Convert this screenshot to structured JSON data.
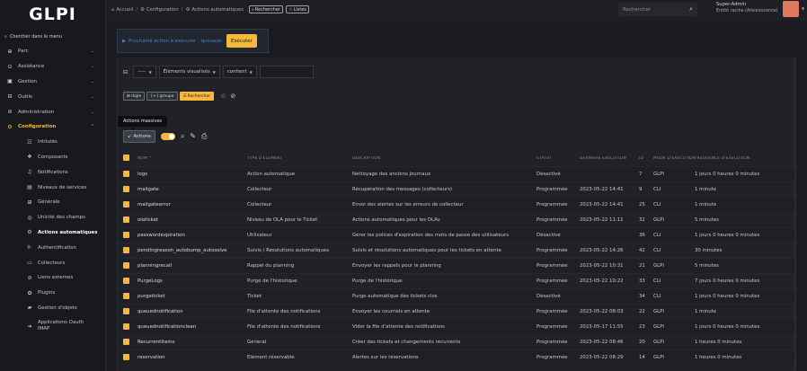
{
  "app": {
    "logo": "GLPI"
  },
  "sidebar": {
    "search_label": "Chercher dans le menu",
    "items": [
      {
        "label": "Parc",
        "icon": "parc-icon",
        "glyph": "⊕"
      },
      {
        "label": "Assistance",
        "icon": "assistance-icon",
        "glyph": "⊙"
      },
      {
        "label": "Gestion",
        "icon": "gestion-icon",
        "glyph": "▣"
      },
      {
        "label": "Outils",
        "icon": "outils-icon",
        "glyph": "⊟"
      },
      {
        "label": "Administration",
        "icon": "administration-icon",
        "glyph": "⊘"
      },
      {
        "label": "Configuration",
        "icon": "configuration-icon",
        "glyph": "⚙"
      }
    ],
    "sub_items": [
      {
        "label": "Intitulés",
        "icon": "dropdowns-icon",
        "glyph": "☷"
      },
      {
        "label": "Composants",
        "icon": "components-icon",
        "glyph": "❖"
      },
      {
        "label": "Notifications",
        "icon": "bell-icon",
        "glyph": "♫"
      },
      {
        "label": "Niveaux de services",
        "icon": "sla-icon",
        "glyph": "▤"
      },
      {
        "label": "Générale",
        "icon": "general-icon",
        "glyph": "⊞"
      },
      {
        "label": "Unicité des champs",
        "icon": "fingerprint-icon",
        "glyph": "◎"
      },
      {
        "label": "Actions automatiques",
        "icon": "crontask-icon",
        "glyph": "⚙"
      },
      {
        "label": "Authentification",
        "icon": "auth-icon",
        "glyph": "⊩"
      },
      {
        "label": "Collecteurs",
        "icon": "collector-icon",
        "glyph": "▭"
      },
      {
        "label": "Liens externes",
        "icon": "link-icon",
        "glyph": "⊘"
      },
      {
        "label": "Plugins",
        "icon": "plugin-icon",
        "glyph": "✿"
      },
      {
        "label": "Gestion d'objets",
        "icon": "objects-icon",
        "glyph": "▰"
      },
      {
        "label": "Applications Oauth IMAP",
        "icon": "oauth-icon",
        "glyph": "➜"
      }
    ]
  },
  "topbar": {
    "crumbs": [
      "Accueil",
      "Configuration",
      "Actions automatiques"
    ],
    "search_btn": "Rechercher",
    "lists_btn": "Listes",
    "search_placeholder": "Rechercher",
    "user_name": "Super-Admin",
    "user_entity": "Entité racine (Arborescence)"
  },
  "notice": {
    "text": "Prochaine action à exécuter : queuedn",
    "exec_label": "Exécuter"
  },
  "filter": {
    "field1": "-----",
    "field2": "Éléments visualisés",
    "field3": "contient",
    "value": ""
  },
  "buttons": {
    "rule": "règle",
    "group": "groupe",
    "search": "Rechercher"
  },
  "tooltip": "Actions massives",
  "actions_label": "Actions",
  "table": {
    "headers": [
      "Nom",
      "Type d'élément",
      "Description",
      "Statut",
      "Dernière exécution",
      "ID",
      "Mode d'exécution",
      "Fréquence d'exécution"
    ],
    "rows": [
      [
        "logs",
        "Action automatique",
        "Nettoyage des anciens journaux",
        "Désactivé",
        "",
        "7",
        "GLPI",
        "1 jours 0 heures 0 minutes"
      ],
      [
        "mailgate",
        "Collecteur",
        "Récupération des messages (collecteurs)",
        "Programmée",
        "2023-05-22 14:41",
        "9",
        "CLI",
        "1 minute"
      ],
      [
        "mailgateerror",
        "Collecteur",
        "Envoi des alertes sur les erreurs de collecteur",
        "Programmée",
        "2023-05-22 14:41",
        "25",
        "CLI",
        "1 minute"
      ],
      [
        "olaticket",
        "Niveau de OLA pour le Ticket",
        "Actions automatiques pour les OLAs",
        "Programmée",
        "2023-05-22 11:11",
        "32",
        "GLPI",
        "5 minutes"
      ],
      [
        "passwordexpiration",
        "Utilisateur",
        "Gérer les polices d'expiration des mots de passe des utilisateurs",
        "Désactivé",
        "",
        "36",
        "CLI",
        "1 jours 0 heures 0 minutes"
      ],
      [
        "pendingreason_autobump_autosolve",
        "Suivis / Résolutions automatiques",
        "Suivis et résolutions automatiques pour les tickets en attente",
        "Programmée",
        "2023-05-22 14:26",
        "42",
        "CLI",
        "30 minutes"
      ],
      [
        "planningrecall",
        "Rappel du planning",
        "Envoyer les rappels pour le planning",
        "Programmée",
        "2023-05-22 10:31",
        "21",
        "GLPI",
        "5 minutes"
      ],
      [
        "PurgeLogs",
        "Purge de l'historique",
        "Purge de l'historique",
        "Programmée",
        "2023-05-22 10:22",
        "33",
        "CLI",
        "7 jours 0 heures 0 minutes"
      ],
      [
        "purgeticket",
        "Ticket",
        "Purge automatique des tickets clos",
        "Désactivé",
        "",
        "34",
        "CLI",
        "1 jours 0 heures 0 minutes"
      ],
      [
        "queuednotification",
        "File d'attente des notifications",
        "Envoyer les courriels en attente",
        "Programmée",
        "2023-05-22 08:03",
        "22",
        "GLPI",
        "1 minute"
      ],
      [
        "queuednotificationclean",
        "File d'attente des notifications",
        "Vider la file d'attente des notifications",
        "Programmée",
        "2023-05-17 11:55",
        "23",
        "GLPI",
        "1 jours 0 heures 0 minutes"
      ],
      [
        "RecurrentItems",
        "Général",
        "Créer des tickets et changements récurrents",
        "Programmée",
        "2023-05-22 08:46",
        "20",
        "GLPI",
        "1 heures 0 minutes"
      ],
      [
        "reservation",
        "Élément réservable",
        "Alertes sur les réservations",
        "Programmée",
        "2023-05-22 08:29",
        "14",
        "GLPI",
        "1 heures 0 minutes"
      ]
    ]
  },
  "colors": {
    "accent": "#f5b83d",
    "notice_text": "#4a7fc4",
    "avatar": "#e07a5f"
  }
}
